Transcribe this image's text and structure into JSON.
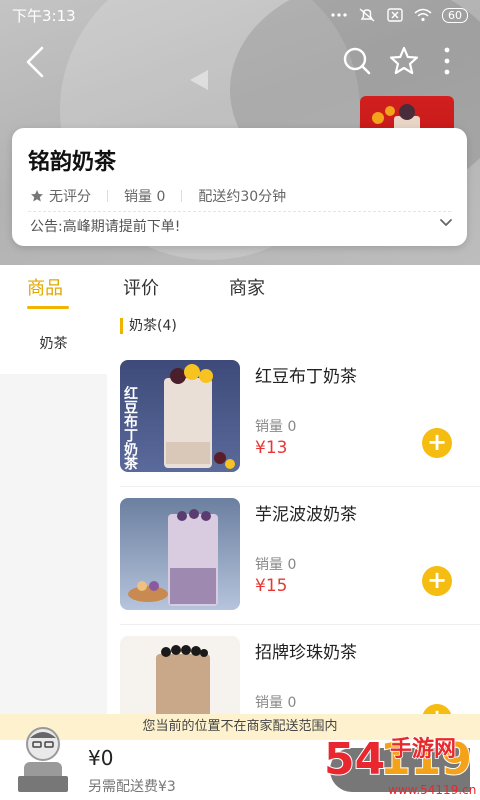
{
  "status_bar": {
    "time": "下午3:13",
    "battery": "60"
  },
  "shop": {
    "name": "铭韵奶茶",
    "rating": "无评分",
    "sales": "销量 0",
    "delivery_time": "配送约30分钟",
    "notice": "公告:高峰期请提前下单!"
  },
  "tabs": [
    "商品",
    "评价",
    "商家"
  ],
  "sidebar": {
    "categories": [
      "奶茶"
    ]
  },
  "section": {
    "title": "奶茶(4)"
  },
  "products": [
    {
      "name": "红豆布丁奶茶",
      "sales": "销量 0",
      "price": "¥13",
      "image_text": "红豆布丁奶茶"
    },
    {
      "name": "芋泥波波奶茶",
      "sales": "销量 0",
      "price": "¥15"
    },
    {
      "name": "招牌珍珠奶茶",
      "sales": "销量 0",
      "price": ""
    }
  ],
  "bottom": {
    "delivery_notice": "您当前的位置不在商家配送范围内",
    "total": "¥0",
    "delivery_fee": "另需配送费¥3"
  },
  "watermark": {
    "text": "54119手游网",
    "url": "www.54119.cn"
  },
  "colors": {
    "accent": "#f5bc12",
    "price": "#e53935"
  }
}
